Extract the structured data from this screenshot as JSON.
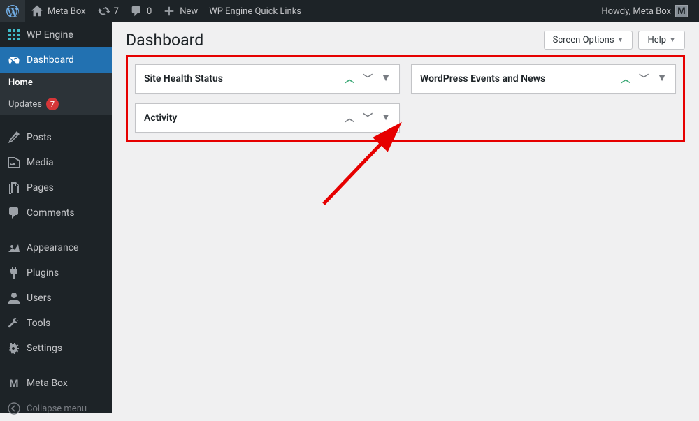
{
  "adminbar": {
    "site_name": "Meta Box",
    "updates_count": "7",
    "comments_count": "0",
    "new_label": "New",
    "quicklinks_label": "WP Engine Quick Links",
    "howdy_prefix": "Howdy, ",
    "user_name": "Meta Box",
    "avatar_letter": "M"
  },
  "sidebar": {
    "wp_engine": "WP Engine",
    "dashboard": "Dashboard",
    "home": "Home",
    "updates": "Updates",
    "updates_count": "7",
    "posts": "Posts",
    "media": "Media",
    "pages": "Pages",
    "comments": "Comments",
    "appearance": "Appearance",
    "plugins": "Plugins",
    "users": "Users",
    "tools": "Tools",
    "settings": "Settings",
    "meta_box": "Meta Box",
    "collapse": "Collapse menu"
  },
  "content": {
    "title": "Dashboard",
    "screen_options": "Screen Options",
    "help": "Help",
    "panels": {
      "site_health": "Site Health Status",
      "activity": "Activity",
      "events": "WordPress Events and News"
    }
  }
}
